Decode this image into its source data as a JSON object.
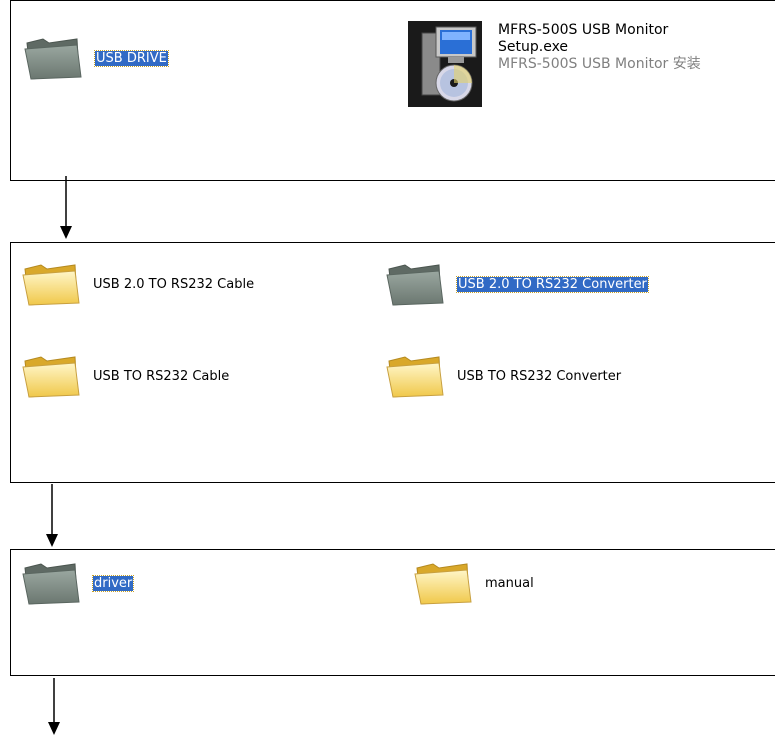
{
  "panels": [
    {
      "items": [
        {
          "label": "USB DRIVE",
          "icon": "folder-gray",
          "selected": true
        }
      ],
      "file": {
        "icon": "installer-icon",
        "name_line1": "MFRS-500S USB  Monitor",
        "name_line2": "Setup.exe",
        "description": "MFRS-500S USB  Monitor 安装"
      }
    },
    {
      "items": [
        {
          "label": "USB 2.0 TO RS232 Cable",
          "icon": "folder-yellow",
          "selected": false
        },
        {
          "label": "USB 2.0 TO RS232 Converter",
          "icon": "folder-gray",
          "selected": true
        },
        {
          "label": "USB TO RS232 Cable",
          "icon": "folder-yellow",
          "selected": false
        },
        {
          "label": "USB TO RS232 Converter",
          "icon": "folder-yellow",
          "selected": false
        }
      ]
    },
    {
      "items": [
        {
          "label": "driver",
          "icon": "folder-gray",
          "selected": true
        },
        {
          "label": "manual",
          "icon": "folder-yellow",
          "selected": false
        }
      ]
    }
  ],
  "colors": {
    "selection": "#316ac5",
    "folder_yellow": "#f5d96b",
    "folder_gray": "#7f8c84",
    "desc_gray": "#808080"
  }
}
